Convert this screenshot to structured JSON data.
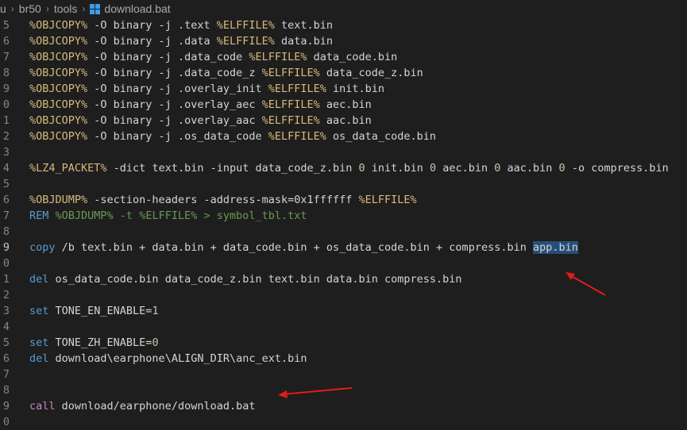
{
  "breadcrumb": {
    "parts": [
      "u",
      "br50",
      "tools"
    ],
    "file": "download.bat",
    "file_icon": "windows-batch-file-icon"
  },
  "colors": {
    "background": "#1e1e1e",
    "variable": "#d7ba7d",
    "keyword": "#569cd6",
    "comment": "#6a9955",
    "number": "#b5cea8",
    "call": "#c586c0",
    "selection": "#264f78",
    "annotation_arrow": "#e21b1b"
  },
  "editor": {
    "lines": [
      {
        "n": "5",
        "tokens": [
          {
            "t": "%OBJCOPY%",
            "c": "var"
          },
          {
            "t": " -O binary -j .text "
          },
          {
            "t": "%ELFFILE%",
            "c": "var"
          },
          {
            "t": " text.bin"
          }
        ]
      },
      {
        "n": "6",
        "tokens": [
          {
            "t": "%OBJCOPY%",
            "c": "var"
          },
          {
            "t": " -O binary -j .data "
          },
          {
            "t": "%ELFFILE%",
            "c": "var"
          },
          {
            "t": " data.bin"
          }
        ]
      },
      {
        "n": "7",
        "tokens": [
          {
            "t": "%OBJCOPY%",
            "c": "var"
          },
          {
            "t": " -O binary -j .data_code "
          },
          {
            "t": "%ELFFILE%",
            "c": "var"
          },
          {
            "t": " data_code.bin"
          }
        ]
      },
      {
        "n": "8",
        "tokens": [
          {
            "t": "%OBJCOPY%",
            "c": "var"
          },
          {
            "t": " -O binary -j .data_code_z "
          },
          {
            "t": "%ELFFILE%",
            "c": "var"
          },
          {
            "t": " data_code_z.bin"
          }
        ]
      },
      {
        "n": "9",
        "tokens": [
          {
            "t": "%OBJCOPY%",
            "c": "var"
          },
          {
            "t": " -O binary -j .overlay_init "
          },
          {
            "t": "%ELFFILE%",
            "c": "var"
          },
          {
            "t": " init.bin"
          }
        ]
      },
      {
        "n": "0",
        "tokens": [
          {
            "t": "%OBJCOPY%",
            "c": "var"
          },
          {
            "t": " -O binary -j .overlay_aec "
          },
          {
            "t": "%ELFFILE%",
            "c": "var"
          },
          {
            "t": " aec.bin"
          }
        ]
      },
      {
        "n": "1",
        "tokens": [
          {
            "t": "%OBJCOPY%",
            "c": "var"
          },
          {
            "t": " -O binary -j .overlay_aac "
          },
          {
            "t": "%ELFFILE%",
            "c": "var"
          },
          {
            "t": " aac.bin"
          }
        ]
      },
      {
        "n": "2",
        "tokens": [
          {
            "t": "%OBJCOPY%",
            "c": "var"
          },
          {
            "t": " -O binary -j .os_data_code "
          },
          {
            "t": "%ELFFILE%",
            "c": "var"
          },
          {
            "t": " os_data_code.bin"
          }
        ]
      },
      {
        "n": "3",
        "tokens": []
      },
      {
        "n": "4",
        "tokens": [
          {
            "t": "%LZ4_PACKET%",
            "c": "var"
          },
          {
            "t": " -dict text.bin -input data_code_z.bin "
          },
          {
            "t": "0",
            "c": "num"
          },
          {
            "t": " init.bin "
          },
          {
            "t": "0",
            "c": "num"
          },
          {
            "t": " aec.bin "
          },
          {
            "t": "0",
            "c": "num"
          },
          {
            "t": " aac.bin "
          },
          {
            "t": "0",
            "c": "num"
          },
          {
            "t": " -o compress.bin"
          }
        ]
      },
      {
        "n": "5",
        "tokens": []
      },
      {
        "n": "6",
        "tokens": [
          {
            "t": "%OBJDUMP%",
            "c": "var"
          },
          {
            "t": " -section-headers -address-mask=0x1ffffff "
          },
          {
            "t": "%ELFFILE%",
            "c": "var"
          }
        ]
      },
      {
        "n": "7",
        "tokens": [
          {
            "t": "REM ",
            "c": "kw"
          },
          {
            "t": "%OBJDUMP%",
            "c": "cm"
          },
          {
            "t": " -t ",
            "c": "cm"
          },
          {
            "t": "%ELFFILE%",
            "c": "cm"
          },
          {
            "t": " > symbol_tbl.txt",
            "c": "cm"
          }
        ]
      },
      {
        "n": "8",
        "tokens": []
      },
      {
        "n": "9",
        "active": true,
        "tokens": [
          {
            "t": "copy",
            "c": "kw"
          },
          {
            "t": " /b text.bin + data.bin + data_code.bin + os_data_code.bin + compress.bin "
          },
          {
            "t": "app.bin",
            "c": "sel"
          }
        ]
      },
      {
        "n": "0",
        "tokens": []
      },
      {
        "n": "1",
        "tokens": [
          {
            "t": "del",
            "c": "kw"
          },
          {
            "t": " os_data_code.bin data_code_z.bin text.bin data.bin compress.bin"
          }
        ]
      },
      {
        "n": "2",
        "tokens": []
      },
      {
        "n": "3",
        "tokens": [
          {
            "t": "set",
            "c": "kw"
          },
          {
            "t": " TONE_EN_ENABLE="
          },
          {
            "t": "1",
            "c": "num"
          }
        ]
      },
      {
        "n": "4",
        "tokens": []
      },
      {
        "n": "5",
        "tokens": [
          {
            "t": "set",
            "c": "kw"
          },
          {
            "t": " TONE_ZH_ENABLE="
          },
          {
            "t": "0",
            "c": "num"
          }
        ]
      },
      {
        "n": "6",
        "tokens": [
          {
            "t": "del",
            "c": "kw"
          },
          {
            "t": " download\\earphone\\ALIGN_DIR\\anc_ext.bin"
          }
        ]
      },
      {
        "n": "7",
        "tokens": []
      },
      {
        "n": "8",
        "tokens": []
      },
      {
        "n": "9",
        "tokens": [
          {
            "t": "call",
            "c": "call"
          },
          {
            "t": " download/earphone/download.bat"
          }
        ]
      },
      {
        "n": "0",
        "tokens": []
      }
    ]
  }
}
